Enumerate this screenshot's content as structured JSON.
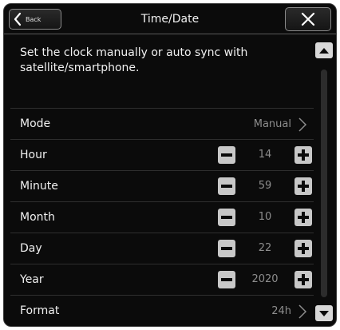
{
  "header": {
    "back_label": "Back",
    "title": "Time/Date"
  },
  "description": "Set the clock manually or auto sync with satellite/smartphone.",
  "rows": [
    {
      "label": "Mode",
      "value": "Manual",
      "kind": "link"
    },
    {
      "label": "Hour",
      "value": "14",
      "kind": "stepper"
    },
    {
      "label": "Minute",
      "value": "59",
      "kind": "stepper"
    },
    {
      "label": "Month",
      "value": "10",
      "kind": "stepper"
    },
    {
      "label": "Day",
      "value": "22",
      "kind": "stepper"
    },
    {
      "label": "Year",
      "value": "2020",
      "kind": "stepper"
    },
    {
      "label": "Format",
      "value": "24h",
      "kind": "link"
    }
  ],
  "icons": {
    "back": "chevron-left-icon",
    "close": "close-icon",
    "row_link": "chevron-right-icon",
    "minus": "minus-icon",
    "plus": "plus-icon",
    "scroll_up": "triangle-up-icon",
    "scroll_down": "triangle-down-icon"
  },
  "colors": {
    "background": "#0b0b0b",
    "text": "#f0f0f0",
    "value_text": "#8d8d8d",
    "button_fill": "#c8c8c8"
  }
}
